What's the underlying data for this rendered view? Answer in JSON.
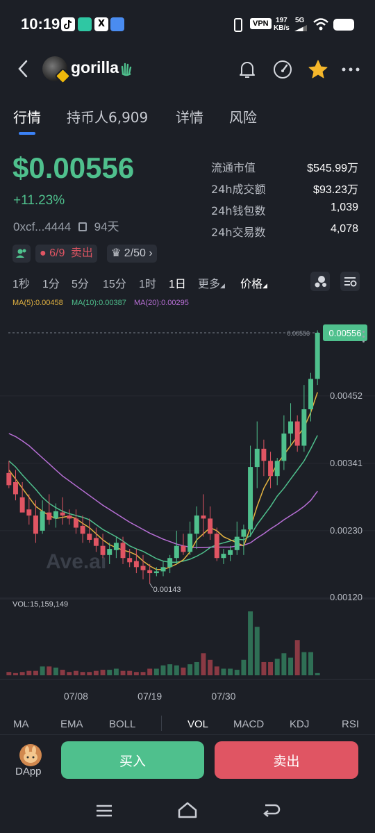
{
  "status_bar": {
    "time": "10:19",
    "vpn": "VPN",
    "net_speed": "197",
    "net_unit": "KB/s",
    "signal": "5G"
  },
  "header": {
    "token_name": "gorilla",
    "icons": [
      "back-icon",
      "bell-icon",
      "gauge-icon",
      "star-icon",
      "more-icon"
    ]
  },
  "tabs": [
    {
      "label": "行情",
      "active": true
    },
    {
      "label": "持币人6,909",
      "active": false
    },
    {
      "label": "详情",
      "active": false
    },
    {
      "label": "风险",
      "active": false
    }
  ],
  "price": {
    "value": "$0.00556",
    "change": "+11.23%",
    "address": "0xcf...4444",
    "age": "94天"
  },
  "stats": [
    {
      "label": "流通市值",
      "value": "$545.99万"
    },
    {
      "label": "24h成交额",
      "value": "$93.23万"
    },
    {
      "label": "24h钱包数",
      "value": "1,039"
    },
    {
      "label": "24h交易数",
      "value": "4,078"
    }
  ],
  "chips": {
    "bag": "6/9",
    "bag_action": "卖出",
    "crown": "2/50"
  },
  "intervals": [
    {
      "label": "1秒"
    },
    {
      "label": "1分"
    },
    {
      "label": "5分"
    },
    {
      "label": "15分"
    },
    {
      "label": "1时"
    },
    {
      "label": "1日",
      "active": true
    },
    {
      "label": "更多"
    },
    {
      "label": "价格"
    }
  ],
  "ma_legend": {
    "ma5": "MA(5):0.00458",
    "ma10": "MA(10):0.00387",
    "ma20": "MA(20):0.00295"
  },
  "colors": {
    "up": "#4fc08d",
    "down": "#e05563",
    "ma5": "#e3b341",
    "ma10": "#4fc08d",
    "ma20": "#b86fd6",
    "accent": "#3b82f6"
  },
  "chart_data": {
    "type": "candlestick",
    "watermark": "Ave.ai",
    "price_axis": [
      "0.00556",
      "0.00452",
      "0.00341",
      "0.00230",
      "0.00120"
    ],
    "current_price_label": "0.00556",
    "current_price_line_label": "0.00556",
    "min_label": "0.00143",
    "date_labels": [
      "07/08",
      "07/19",
      "07/30"
    ],
    "volume_label": "VOL:15,159,149",
    "ylim": [
      0.0012,
      0.0058
    ],
    "candles": [
      {
        "o": 0.00325,
        "h": 0.00345,
        "l": 0.003,
        "c": 0.00305
      },
      {
        "o": 0.0031,
        "h": 0.0033,
        "l": 0.0028,
        "c": 0.0029
      },
      {
        "o": 0.00285,
        "h": 0.0031,
        "l": 0.00265,
        "c": 0.0026
      },
      {
        "o": 0.00265,
        "h": 0.0029,
        "l": 0.0024,
        "c": 0.00255
      },
      {
        "o": 0.00255,
        "h": 0.0028,
        "l": 0.0021,
        "c": 0.00225
      },
      {
        "o": 0.0023,
        "h": 0.0028,
        "l": 0.00225,
        "c": 0.00262
      },
      {
        "o": 0.0026,
        "h": 0.0029,
        "l": 0.0024,
        "c": 0.00248
      },
      {
        "o": 0.0025,
        "h": 0.00275,
        "l": 0.00235,
        "c": 0.00262
      },
      {
        "o": 0.0026,
        "h": 0.00285,
        "l": 0.0024,
        "c": 0.00255
      },
      {
        "o": 0.00255,
        "h": 0.00265,
        "l": 0.0024,
        "c": 0.0025
      },
      {
        "o": 0.0025,
        "h": 0.00265,
        "l": 0.00225,
        "c": 0.00235
      },
      {
        "o": 0.00238,
        "h": 0.00255,
        "l": 0.0021,
        "c": 0.00225
      },
      {
        "o": 0.00225,
        "h": 0.0025,
        "l": 0.0021,
        "c": 0.00215
      },
      {
        "o": 0.00218,
        "h": 0.00235,
        "l": 0.00195,
        "c": 0.00205
      },
      {
        "o": 0.00205,
        "h": 0.00225,
        "l": 0.00185,
        "c": 0.0019
      },
      {
        "o": 0.0019,
        "h": 0.0021,
        "l": 0.00175,
        "c": 0.002
      },
      {
        "o": 0.00198,
        "h": 0.0022,
        "l": 0.00185,
        "c": 0.0021
      },
      {
        "o": 0.0021,
        "h": 0.0022,
        "l": 0.00175,
        "c": 0.00185
      },
      {
        "o": 0.00185,
        "h": 0.002,
        "l": 0.0017,
        "c": 0.00178
      },
      {
        "o": 0.0018,
        "h": 0.002,
        "l": 0.0016,
        "c": 0.0017
      },
      {
        "o": 0.00172,
        "h": 0.0019,
        "l": 0.0015,
        "c": 0.00165
      },
      {
        "o": 0.00165,
        "h": 0.00175,
        "l": 0.00143,
        "c": 0.0016
      },
      {
        "o": 0.0016,
        "h": 0.0017,
        "l": 0.00155,
        "c": 0.00163
      },
      {
        "o": 0.00163,
        "h": 0.0018,
        "l": 0.00155,
        "c": 0.0017
      },
      {
        "o": 0.0017,
        "h": 0.0019,
        "l": 0.0016,
        "c": 0.00185
      },
      {
        "o": 0.00185,
        "h": 0.0023,
        "l": 0.00175,
        "c": 0.00205
      },
      {
        "o": 0.00205,
        "h": 0.00225,
        "l": 0.0019,
        "c": 0.00195
      },
      {
        "o": 0.00195,
        "h": 0.00245,
        "l": 0.0019,
        "c": 0.00225
      },
      {
        "o": 0.00225,
        "h": 0.0027,
        "l": 0.002,
        "c": 0.00255
      },
      {
        "o": 0.00255,
        "h": 0.0029,
        "l": 0.0022,
        "c": 0.0025
      },
      {
        "o": 0.0025,
        "h": 0.0027,
        "l": 0.00215,
        "c": 0.00225
      },
      {
        "o": 0.00225,
        "h": 0.00235,
        "l": 0.0018,
        "c": 0.00185
      },
      {
        "o": 0.00185,
        "h": 0.002,
        "l": 0.00175,
        "c": 0.00192
      },
      {
        "o": 0.0019,
        "h": 0.00205,
        "l": 0.0018,
        "c": 0.00198
      },
      {
        "o": 0.00198,
        "h": 0.00245,
        "l": 0.0019,
        "c": 0.0022
      },
      {
        "o": 0.0022,
        "h": 0.0024,
        "l": 0.0019,
        "c": 0.00232
      },
      {
        "o": 0.00232,
        "h": 0.0037,
        "l": 0.0022,
        "c": 0.00335
      },
      {
        "o": 0.00335,
        "h": 0.0041,
        "l": 0.003,
        "c": 0.00365
      },
      {
        "o": 0.00365,
        "h": 0.0038,
        "l": 0.0032,
        "c": 0.00345
      },
      {
        "o": 0.00345,
        "h": 0.0036,
        "l": 0.003,
        "c": 0.0032
      },
      {
        "o": 0.0032,
        "h": 0.0035,
        "l": 0.00305,
        "c": 0.00345
      },
      {
        "o": 0.00345,
        "h": 0.0042,
        "l": 0.0033,
        "c": 0.0039
      },
      {
        "o": 0.0039,
        "h": 0.0044,
        "l": 0.0037,
        "c": 0.0041
      },
      {
        "o": 0.0041,
        "h": 0.0042,
        "l": 0.0036,
        "c": 0.0037
      },
      {
        "o": 0.0037,
        "h": 0.0047,
        "l": 0.0036,
        "c": 0.0043
      },
      {
        "o": 0.0043,
        "h": 0.0049,
        "l": 0.0041,
        "c": 0.0048
      },
      {
        "o": 0.0048,
        "h": 0.0056,
        "l": 0.0047,
        "c": 0.00556
      }
    ],
    "volumes": [
      3,
      2,
      3,
      4,
      4,
      8,
      8,
      7,
      5,
      3,
      4,
      3,
      3,
      4,
      5,
      5,
      6,
      4,
      4,
      3,
      3,
      6,
      6,
      9,
      10,
      9,
      7,
      10,
      12,
      20,
      14,
      8,
      6,
      6,
      5,
      14,
      58,
      44,
      12,
      12,
      15,
      20,
      16,
      32,
      21,
      21,
      2
    ],
    "ma5": [
      0.0033,
      0.00315,
      0.003,
      0.00285,
      0.0027,
      0.00262,
      0.00255,
      0.0025,
      0.00252,
      0.00254,
      0.0025,
      0.00242,
      0.00235,
      0.00225,
      0.00215,
      0.00207,
      0.00202,
      0.00198,
      0.00195,
      0.0019,
      0.0018,
      0.00172,
      0.00166,
      0.00166,
      0.0017,
      0.00175,
      0.00182,
      0.00195,
      0.00215,
      0.00225,
      0.00235,
      0.0023,
      0.0022,
      0.00215,
      0.0021,
      0.00205,
      0.00235,
      0.0027,
      0.003,
      0.0032,
      0.0034,
      0.00355,
      0.0037,
      0.00385,
      0.004,
      0.00425,
      0.00458
    ],
    "ma10": [
      0.00345,
      0.00335,
      0.00322,
      0.0031,
      0.00298,
      0.00285,
      0.00275,
      0.00268,
      0.00262,
      0.00258,
      0.00255,
      0.00252,
      0.00248,
      0.0024,
      0.00232,
      0.00226,
      0.0022,
      0.00213,
      0.00205,
      0.002,
      0.00196,
      0.0019,
      0.00184,
      0.0018,
      0.00178,
      0.00178,
      0.0018,
      0.00183,
      0.00188,
      0.00194,
      0.00202,
      0.00207,
      0.0021,
      0.00213,
      0.00216,
      0.00215,
      0.00222,
      0.0024,
      0.00255,
      0.0027,
      0.00287,
      0.003,
      0.00315,
      0.0033,
      0.00345,
      0.00365,
      0.00387
    ],
    "ma20": [
      0.0039,
      0.00385,
      0.00378,
      0.0037,
      0.0036,
      0.0035,
      0.0034,
      0.0033,
      0.0032,
      0.00312,
      0.00304,
      0.00296,
      0.00288,
      0.0028,
      0.00272,
      0.00265,
      0.00258,
      0.00251,
      0.00244,
      0.00238,
      0.00232,
      0.00226,
      0.00221,
      0.00216,
      0.00212,
      0.00208,
      0.00205,
      0.00203,
      0.00202,
      0.00202,
      0.00203,
      0.00203,
      0.00203,
      0.00203,
      0.00205,
      0.00206,
      0.0021,
      0.00218,
      0.00225,
      0.00233,
      0.0024,
      0.00248,
      0.00255,
      0.00262,
      0.0027,
      0.0028,
      0.00295
    ]
  },
  "indicators": [
    {
      "label": "MA"
    },
    {
      "label": "EMA"
    },
    {
      "label": "BOLL"
    },
    {
      "label": "VOL",
      "active": true
    },
    {
      "label": "MACD"
    },
    {
      "label": "KDJ"
    },
    {
      "label": "RSI"
    }
  ],
  "bottom": {
    "dapp_label": "DApp",
    "buy_label": "买入",
    "sell_label": "卖出"
  }
}
